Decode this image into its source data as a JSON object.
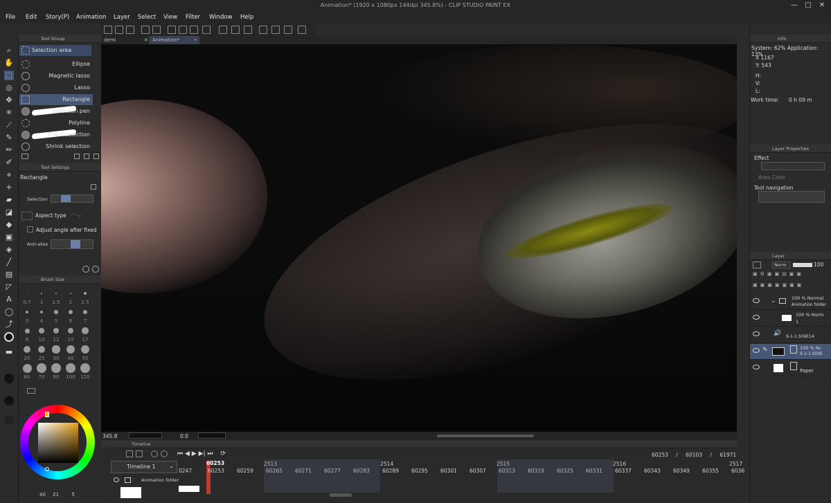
{
  "window": {
    "title": "Animation* (1920 x 1080px 144dpi 345.8%) - CLIP STUDIO PAINT EX",
    "minimize": "—",
    "maximize": "□",
    "close": "✕"
  },
  "menu": [
    "File",
    "Edit",
    "Story(P)",
    "Animation",
    "Layer",
    "Select",
    "View",
    "Filter",
    "Window",
    "Help"
  ],
  "doc_tabs": [
    "demi",
    "Animation*"
  ],
  "tool_group": {
    "header": "Tool Group",
    "active_title": "Selection area",
    "items": [
      "Ellipse",
      "Magnetic lasso",
      "Lasso",
      "Rectangle",
      "Selection pen",
      "Polyline",
      "Erase selection",
      "Shrink selection"
    ],
    "selected": "Rectangle"
  },
  "tool_settings": {
    "header": "Tool Settings",
    "tool_name": "Rectangle",
    "selection_label": "Selection",
    "aspect_label": "Aspect type",
    "adjust_label": "Adjust angle after fixed",
    "antialias_label": "Anti-alias"
  },
  "brush_size": {
    "header": "Brush Size",
    "sizes": [
      "0.7",
      "1",
      "1.5",
      "2",
      "2.5",
      "3",
      "4",
      "5",
      "6",
      "7",
      "8",
      "10",
      "12",
      "15",
      "17",
      "20",
      "25",
      "30",
      "40",
      "50",
      "60",
      "70",
      "80",
      "100",
      "120"
    ]
  },
  "color_readout": {
    "a": "40",
    "b": "21",
    "c": "5"
  },
  "info": {
    "header": "Info",
    "system": "System: 62% Application: 13%",
    "x": "X 1167",
    "y": "Y: 543",
    "h": "H:",
    "v": "V:",
    "l": "L:",
    "work_time_label": "Work time:",
    "work_time_value": "0 h 09 m"
  },
  "layer_properties": {
    "header": "Layer Properties",
    "effect": "Effect",
    "area_color": "Area Color",
    "tool_navigation": "Tool navigation"
  },
  "layer": {
    "header": "Layer",
    "blend": "Norm",
    "opacity": "100",
    "rows": [
      {
        "percent": "100 % Normal",
        "name": "Animation folder"
      },
      {
        "percent": "100 % Norm",
        "name": "1"
      },
      {
        "percent": "",
        "name": "9-1-1.S09E14"
      },
      {
        "percent": "100 % Nc",
        "name": "9-1-1.S09E"
      },
      {
        "percent": "",
        "name": "Paper"
      }
    ]
  },
  "status": {
    "zoom": "345.8",
    "angle": "0.0"
  },
  "timeline": {
    "header": "Timeline",
    "name": "Timeline 1",
    "current": "60253",
    "counter_current": "60253",
    "counter_start": "60103",
    "counter_end": "61971",
    "seconds": [
      "2513",
      "2514",
      "2515",
      "2516",
      "2517"
    ],
    "frames": [
      "0247",
      "60253",
      "60259",
      "60265",
      "60271",
      "60277",
      "60283",
      "60289",
      "60295",
      "60301",
      "60307",
      "60313",
      "60319",
      "60325",
      "60331",
      "60337",
      "60343",
      "60349",
      "60355",
      "6036"
    ],
    "track_name": "Animation folder"
  },
  "colors": {
    "selected_row": "#465775",
    "playhead": "#c0392b",
    "canvas": "#0b0b0b"
  }
}
